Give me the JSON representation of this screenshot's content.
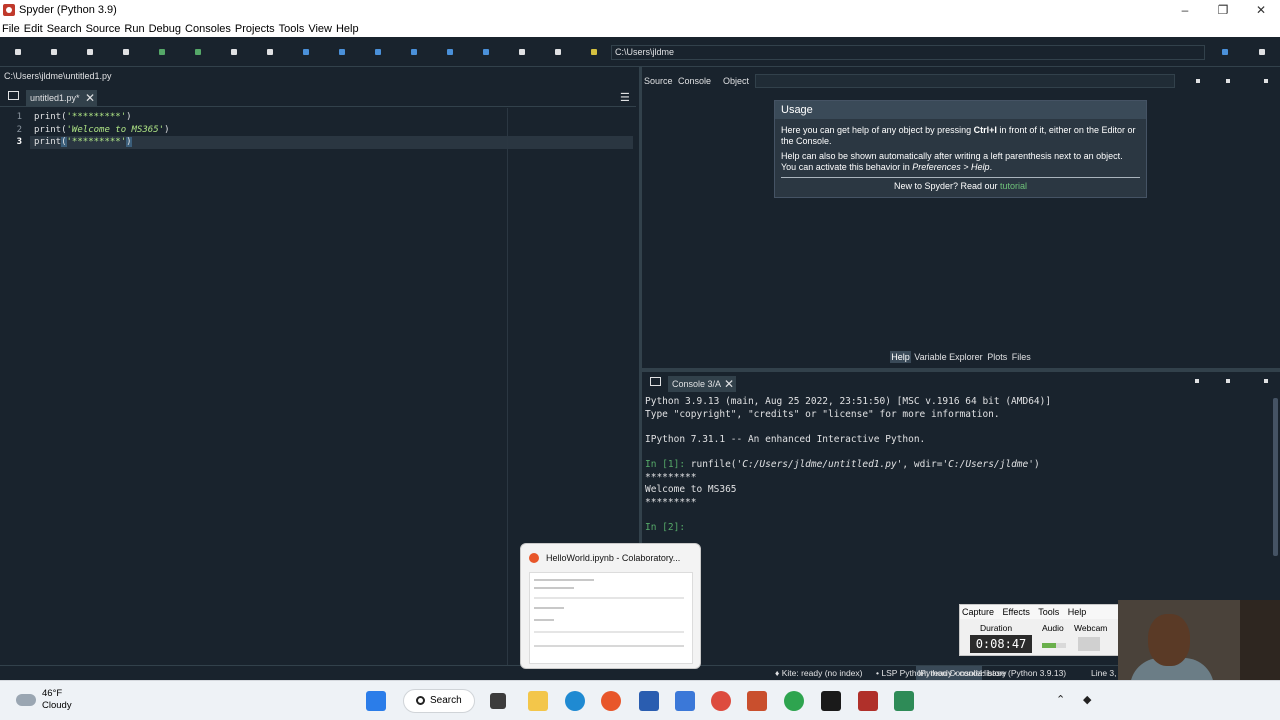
{
  "window": {
    "title": "Spyder (Python 3.9)"
  },
  "menu": [
    "File",
    "Edit",
    "Search",
    "Source",
    "Run",
    "Debug",
    "Consoles",
    "Projects",
    "Tools",
    "View",
    "Help"
  ],
  "toolbar": {
    "path": "C:\\Users\\jldme"
  },
  "editor": {
    "file_path": "C:\\Users\\jldme\\untitled1.py",
    "tab_label": "untitled1.py*",
    "line_numbers": [
      "1",
      "2",
      "3"
    ],
    "lines": [
      {
        "fn": "print(",
        "str": "'*********'",
        "end": ")"
      },
      {
        "fn": "print(",
        "str": "'Welcome to MS365'",
        "end": ")"
      },
      {
        "fn": "print",
        "open": "(",
        "str": "'*********'",
        "end": ")"
      }
    ]
  },
  "help": {
    "source_label": "Source",
    "console_label": "Console",
    "object_label": "Object",
    "usage_title": "Usage",
    "p1_a": "Here you can get help of any object by pressing ",
    "p1_key": "Ctrl+I",
    "p1_b": " in front of it, either on the Editor or the Console.",
    "p2_a": "Help can also be shown automatically after writing a left parenthesis next to an object. You can activate this behavior in ",
    "p2_pref": "Preferences > Help",
    "p2_b": ".",
    "new_a": "New to Spyder? Read our ",
    "new_link": "tutorial",
    "tabs": [
      "Help",
      "Variable Explorer",
      "Plots",
      "Files"
    ]
  },
  "console": {
    "tab_label": "Console 3/A",
    "line1": "Python 3.9.13 (main, Aug 25 2022, 23:51:50) [MSC v.1916 64 bit (AMD64)]",
    "line2": "Type \"copyright\", \"credits\" or \"license\" for more information.",
    "line3": "IPython 7.31.1 -- An enhanced Interactive Python.",
    "in1_prompt": "In [1]:",
    "in1_cmd_a": " runfile(",
    "in1_cmd_file": "'C:/Users/jldme/untitled1.py'",
    "in1_cmd_b": ", wdir=",
    "in1_cmd_dir": "'C:/Users/jldme'",
    "in1_cmd_c": ")",
    "out1": "*********",
    "out2": "Welcome to MS365",
    "out3": "*********",
    "in2_prompt": "In [2]:"
  },
  "statusbar": {
    "ipython_tab": "IPython Console",
    "history_tab": "History",
    "kite": "Kite: ready (no index)",
    "lsp": "LSP Python: ready",
    "conda": "conda: base (Python 3.9.13)",
    "line": "Line 3,"
  },
  "preview": {
    "title": "HelloWorld.ipynb - Colaboratory..."
  },
  "recorder": {
    "menu": [
      "Capture",
      "Effects",
      "Tools",
      "Help"
    ],
    "duration_label": "Duration",
    "audio_label": "Audio",
    "webcam_label": "Webcam",
    "duration": "0:08:47"
  },
  "taskbar": {
    "temp": "46°F",
    "condition": "Cloudy",
    "search_label": "Search"
  }
}
